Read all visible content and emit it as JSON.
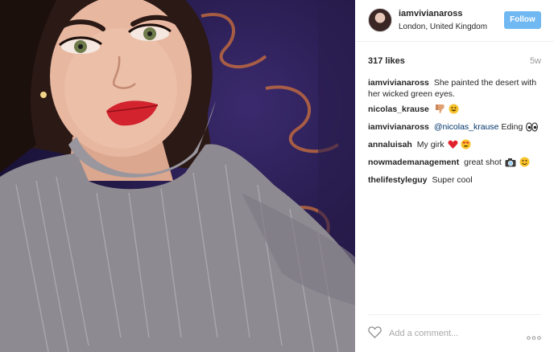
{
  "post": {
    "username": "iamvivianaross",
    "location": "London, United Kingdom",
    "follow_label": "Follow",
    "likes": "317 likes",
    "time_ago": "5w"
  },
  "comments": [
    {
      "user": "iamvivianaross",
      "text": "She painted the desert with her wicked green eyes."
    },
    {
      "user": "nicolas_krause",
      "text": "",
      "emojis": [
        "thumbs-down-emoji",
        "grinning-emoji"
      ]
    },
    {
      "user": "iamvivianaross",
      "mention": "@nicolas_krause",
      "text": "Eding",
      "emojis": [
        "eyes-emoji"
      ]
    },
    {
      "user": "annaluisah",
      "text": "My girk",
      "emojis": [
        "red-heart-emoji",
        "heart-eyes-emoji"
      ]
    },
    {
      "user": "nowmademanagement",
      "text": "great shot",
      "emojis": [
        "camera-emoji",
        "smiling-emoji"
      ]
    },
    {
      "user": "thelifestyleguy",
      "text": "Super cool"
    }
  ],
  "footer": {
    "comment_placeholder": "Add a comment...",
    "like_icon": "heart-outline-icon",
    "more_icon": "more-options-icon"
  },
  "colors": {
    "follow_button": "#70b8f2",
    "mention": "#003569",
    "muted": "#999999",
    "divider": "#efefef"
  }
}
